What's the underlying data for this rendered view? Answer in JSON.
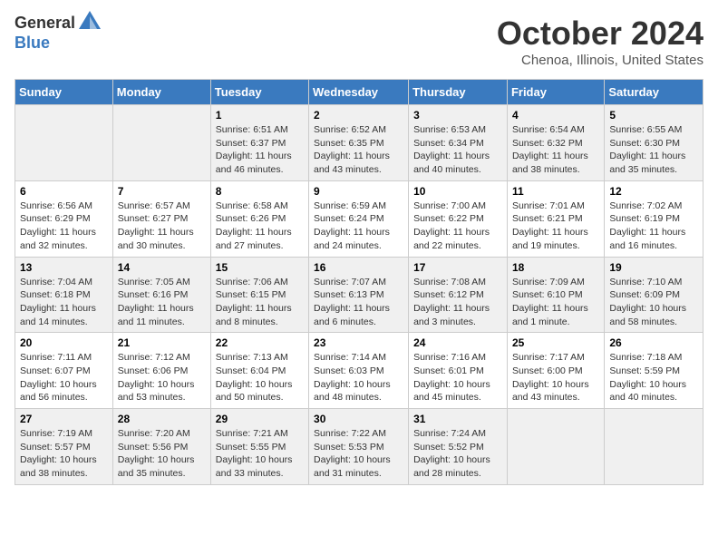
{
  "logo": {
    "general": "General",
    "blue": "Blue"
  },
  "title": {
    "month": "October 2024",
    "location": "Chenoa, Illinois, United States"
  },
  "headers": [
    "Sunday",
    "Monday",
    "Tuesday",
    "Wednesday",
    "Thursday",
    "Friday",
    "Saturday"
  ],
  "weeks": [
    [
      {
        "day": "",
        "info": ""
      },
      {
        "day": "",
        "info": ""
      },
      {
        "day": "1",
        "info": "Sunrise: 6:51 AM\nSunset: 6:37 PM\nDaylight: 11 hours and 46 minutes."
      },
      {
        "day": "2",
        "info": "Sunrise: 6:52 AM\nSunset: 6:35 PM\nDaylight: 11 hours and 43 minutes."
      },
      {
        "day": "3",
        "info": "Sunrise: 6:53 AM\nSunset: 6:34 PM\nDaylight: 11 hours and 40 minutes."
      },
      {
        "day": "4",
        "info": "Sunrise: 6:54 AM\nSunset: 6:32 PM\nDaylight: 11 hours and 38 minutes."
      },
      {
        "day": "5",
        "info": "Sunrise: 6:55 AM\nSunset: 6:30 PM\nDaylight: 11 hours and 35 minutes."
      }
    ],
    [
      {
        "day": "6",
        "info": "Sunrise: 6:56 AM\nSunset: 6:29 PM\nDaylight: 11 hours and 32 minutes."
      },
      {
        "day": "7",
        "info": "Sunrise: 6:57 AM\nSunset: 6:27 PM\nDaylight: 11 hours and 30 minutes."
      },
      {
        "day": "8",
        "info": "Sunrise: 6:58 AM\nSunset: 6:26 PM\nDaylight: 11 hours and 27 minutes."
      },
      {
        "day": "9",
        "info": "Sunrise: 6:59 AM\nSunset: 6:24 PM\nDaylight: 11 hours and 24 minutes."
      },
      {
        "day": "10",
        "info": "Sunrise: 7:00 AM\nSunset: 6:22 PM\nDaylight: 11 hours and 22 minutes."
      },
      {
        "day": "11",
        "info": "Sunrise: 7:01 AM\nSunset: 6:21 PM\nDaylight: 11 hours and 19 minutes."
      },
      {
        "day": "12",
        "info": "Sunrise: 7:02 AM\nSunset: 6:19 PM\nDaylight: 11 hours and 16 minutes."
      }
    ],
    [
      {
        "day": "13",
        "info": "Sunrise: 7:04 AM\nSunset: 6:18 PM\nDaylight: 11 hours and 14 minutes."
      },
      {
        "day": "14",
        "info": "Sunrise: 7:05 AM\nSunset: 6:16 PM\nDaylight: 11 hours and 11 minutes."
      },
      {
        "day": "15",
        "info": "Sunrise: 7:06 AM\nSunset: 6:15 PM\nDaylight: 11 hours and 8 minutes."
      },
      {
        "day": "16",
        "info": "Sunrise: 7:07 AM\nSunset: 6:13 PM\nDaylight: 11 hours and 6 minutes."
      },
      {
        "day": "17",
        "info": "Sunrise: 7:08 AM\nSunset: 6:12 PM\nDaylight: 11 hours and 3 minutes."
      },
      {
        "day": "18",
        "info": "Sunrise: 7:09 AM\nSunset: 6:10 PM\nDaylight: 11 hours and 1 minute."
      },
      {
        "day": "19",
        "info": "Sunrise: 7:10 AM\nSunset: 6:09 PM\nDaylight: 10 hours and 58 minutes."
      }
    ],
    [
      {
        "day": "20",
        "info": "Sunrise: 7:11 AM\nSunset: 6:07 PM\nDaylight: 10 hours and 56 minutes."
      },
      {
        "day": "21",
        "info": "Sunrise: 7:12 AM\nSunset: 6:06 PM\nDaylight: 10 hours and 53 minutes."
      },
      {
        "day": "22",
        "info": "Sunrise: 7:13 AM\nSunset: 6:04 PM\nDaylight: 10 hours and 50 minutes."
      },
      {
        "day": "23",
        "info": "Sunrise: 7:14 AM\nSunset: 6:03 PM\nDaylight: 10 hours and 48 minutes."
      },
      {
        "day": "24",
        "info": "Sunrise: 7:16 AM\nSunset: 6:01 PM\nDaylight: 10 hours and 45 minutes."
      },
      {
        "day": "25",
        "info": "Sunrise: 7:17 AM\nSunset: 6:00 PM\nDaylight: 10 hours and 43 minutes."
      },
      {
        "day": "26",
        "info": "Sunrise: 7:18 AM\nSunset: 5:59 PM\nDaylight: 10 hours and 40 minutes."
      }
    ],
    [
      {
        "day": "27",
        "info": "Sunrise: 7:19 AM\nSunset: 5:57 PM\nDaylight: 10 hours and 38 minutes."
      },
      {
        "day": "28",
        "info": "Sunrise: 7:20 AM\nSunset: 5:56 PM\nDaylight: 10 hours and 35 minutes."
      },
      {
        "day": "29",
        "info": "Sunrise: 7:21 AM\nSunset: 5:55 PM\nDaylight: 10 hours and 33 minutes."
      },
      {
        "day": "30",
        "info": "Sunrise: 7:22 AM\nSunset: 5:53 PM\nDaylight: 10 hours and 31 minutes."
      },
      {
        "day": "31",
        "info": "Sunrise: 7:24 AM\nSunset: 5:52 PM\nDaylight: 10 hours and 28 minutes."
      },
      {
        "day": "",
        "info": ""
      },
      {
        "day": "",
        "info": ""
      }
    ]
  ]
}
